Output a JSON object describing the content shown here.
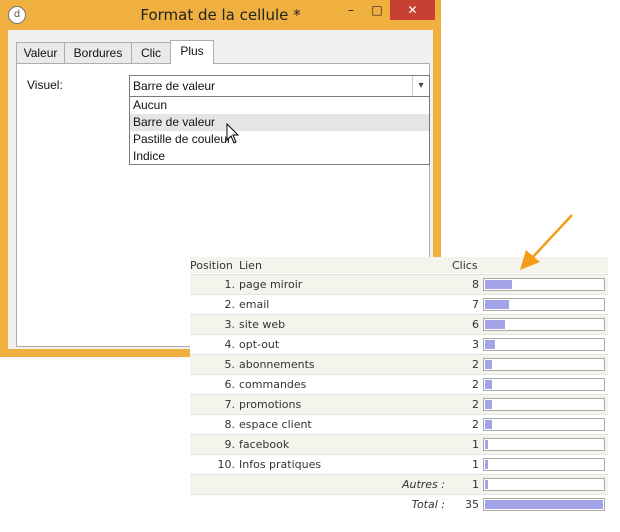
{
  "window": {
    "title": "Format de la cellule *",
    "controls": {
      "minimize": "–",
      "maximize": "□",
      "close": "✕"
    }
  },
  "tabs": [
    {
      "label": "Valeur",
      "active": false
    },
    {
      "label": "Bordures",
      "active": false
    },
    {
      "label": "Clic",
      "active": false
    },
    {
      "label": "Plus",
      "active": true
    }
  ],
  "visuel": {
    "label": "Visuel:",
    "selected": "Barre de valeur",
    "options": [
      "Aucun",
      "Barre de valeur",
      "Pastille de couleur",
      "Indice"
    ]
  },
  "report": {
    "headers": {
      "position": "Position",
      "lien": "Lien",
      "clics": "Clics"
    },
    "rows": [
      {
        "num": "1.",
        "lien": "page miroir",
        "clics": 8
      },
      {
        "num": "2.",
        "lien": "email",
        "clics": 7
      },
      {
        "num": "3.",
        "lien": "site web",
        "clics": 6
      },
      {
        "num": "4.",
        "lien": "opt-out",
        "clics": 3
      },
      {
        "num": "5.",
        "lien": "abonnements",
        "clics": 2
      },
      {
        "num": "6.",
        "lien": "commandes",
        "clics": 2
      },
      {
        "num": "7.",
        "lien": "promotions",
        "clics": 2
      },
      {
        "num": "8.",
        "lien": "espace client",
        "clics": 2
      },
      {
        "num": "9.",
        "lien": "facebook",
        "clics": 1
      },
      {
        "num": "10.",
        "lien": "Infos pratiques",
        "clics": 1
      }
    ],
    "autres": {
      "label": "Autres :",
      "clics": 1
    },
    "total": {
      "label": "Total :",
      "clics": 35
    }
  },
  "colors": {
    "window_frame": "#f0b040",
    "close_button": "#c84031",
    "bar_fill": "#a3a3e8",
    "arrow": "#f39c1a"
  },
  "icons": {
    "app": "app-icon",
    "dropdown": "chevron-down-icon",
    "cursor": "mouse-pointer-icon",
    "arrow": "arrow-icon"
  }
}
